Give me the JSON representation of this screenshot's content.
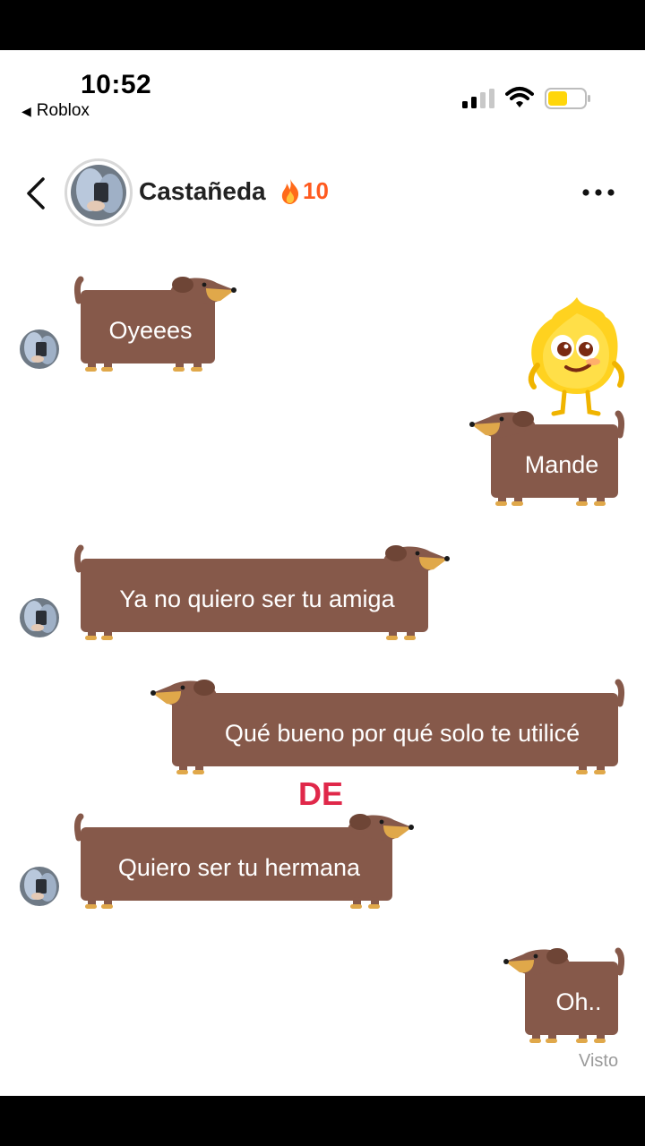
{
  "status_bar": {
    "time": "10:52",
    "back_app": "Roblox",
    "back_app_icon": "back-triangle-icon",
    "battery_color": "#ffd60a"
  },
  "header": {
    "back_icon": "chevron-left-icon",
    "name": "Castañeda",
    "streak_icon": "fire-icon",
    "streak_count": "10",
    "more_icon": "ellipsis-icon"
  },
  "colors": {
    "bubble": "#86594a",
    "bubble_ear": "#6e4536",
    "snout": "#e0a84a",
    "streak": "#ff5a1f",
    "de_text": "#e0284a"
  },
  "messages": [
    {
      "sender": "them",
      "text": "Oyeees"
    },
    {
      "sender": "me",
      "text": "Mande"
    },
    {
      "sender": "them",
      "text": "Ya no quiero ser tu amiga"
    },
    {
      "sender": "me",
      "text": "Qué bueno por qué solo te utilicé"
    },
    {
      "sender": "them",
      "text": "Quiero ser tu hermana"
    },
    {
      "sender": "me",
      "text": "Oh.."
    }
  ],
  "overlay_text": "DE",
  "read_receipt": "Visto"
}
